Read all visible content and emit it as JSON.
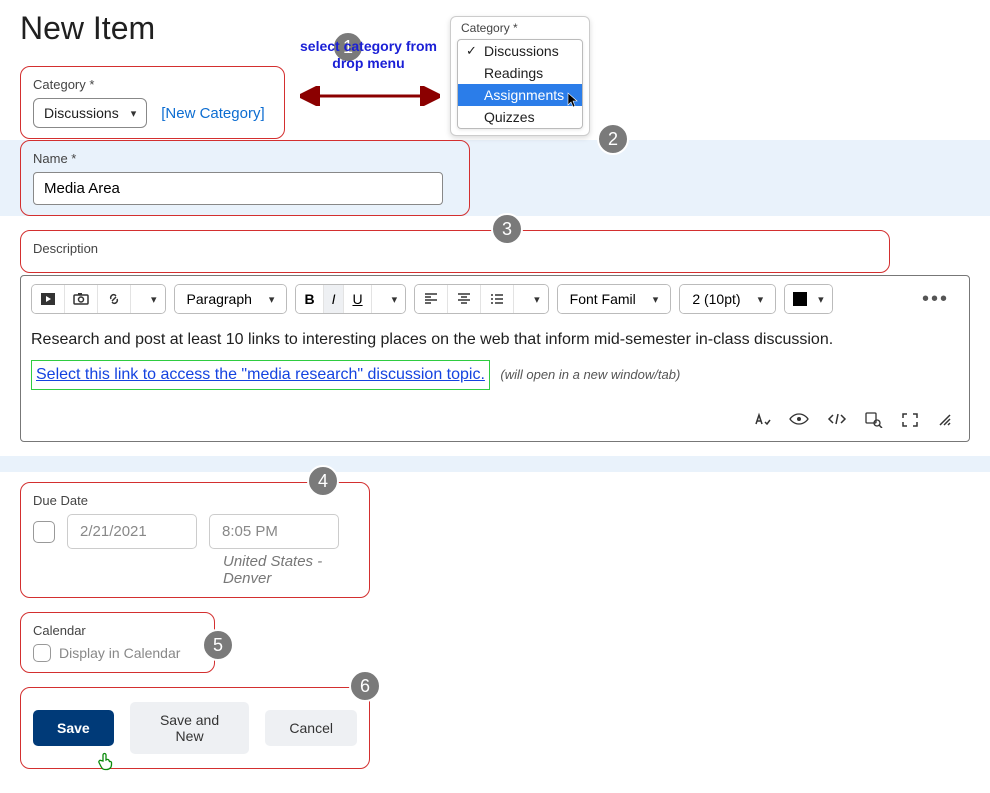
{
  "page_title": "New Item",
  "annotation": {
    "select_text_l1": "select category from",
    "select_text_l2": "drop menu"
  },
  "category_field": {
    "label": "Category *",
    "selected": "Discussions",
    "new_link": "[New Category]"
  },
  "category_dropdown": {
    "label": "Category *",
    "options": [
      "Discussions",
      "Readings",
      "Assignments",
      "Quizzes"
    ],
    "checked_index": 0,
    "highlighted_index": 2
  },
  "name_field": {
    "label": "Name *",
    "value": "Media Area"
  },
  "description": {
    "label": "Description",
    "body_text": "Research and post at least 10 links to interesting places on the web that inform mid-semester in-class discussion.",
    "link_text": "Select this link to access the \"media research\" discussion topic.",
    "link_hint": "(will open in a new window/tab)",
    "toolbar": {
      "paragraph": "Paragraph",
      "font_family": "Font Famil",
      "font_size": "2 (10pt)"
    }
  },
  "due_date": {
    "label": "Due Date",
    "date_placeholder": "2/21/2021",
    "time_placeholder": "8:05 PM",
    "timezone": "United States - Denver"
  },
  "calendar": {
    "label": "Calendar",
    "checkbox_label": "Display in Calendar"
  },
  "buttons": {
    "save": "Save",
    "save_new": "Save and New",
    "cancel": "Cancel"
  },
  "badges": {
    "b1": "1",
    "b2": "2",
    "b3": "3",
    "b4": "4",
    "b5": "5",
    "b6": "6"
  }
}
